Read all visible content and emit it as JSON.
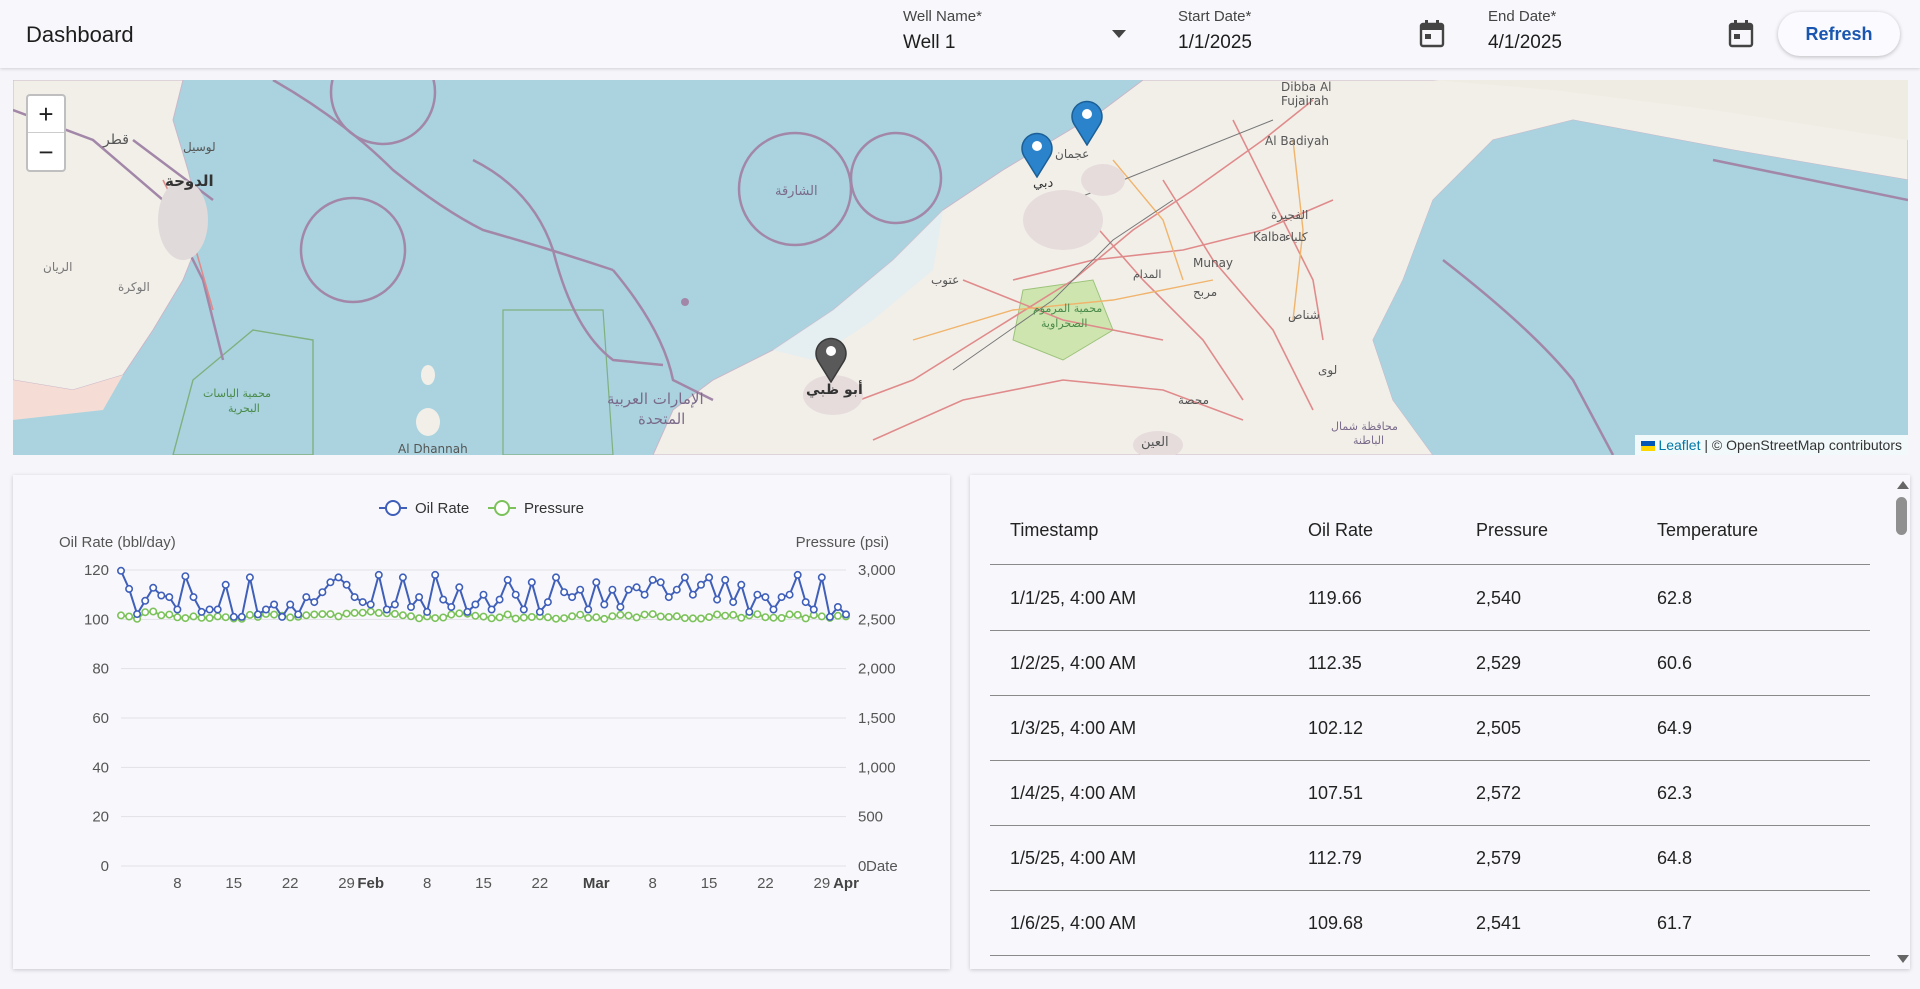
{
  "header": {
    "title": "Dashboard",
    "well_label": "Well Name*",
    "well_value": "Well 1",
    "start_label": "Start Date*",
    "start_value": "1/1/2025",
    "end_label": "End Date*",
    "end_value": "4/1/2025",
    "refresh_label": "Refresh"
  },
  "map": {
    "zoom_in": "+",
    "zoom_out": "−",
    "attribution_link": "Leaflet",
    "attribution_rest": "| © OpenStreetMap contributors",
    "markers": [
      {
        "color": "blue",
        "icon": "map-pin-icon"
      },
      {
        "color": "blue",
        "icon": "map-pin-icon"
      },
      {
        "color": "gray",
        "icon": "map-pin-icon"
      }
    ],
    "labels": [
      "قطر",
      "الدوحة",
      "لوسيل",
      "الريان",
      "الوكرة",
      "الشارقة",
      "عجمان",
      "دبي",
      "أبو ظبي",
      "الإمارات العربية",
      "المتحدة",
      "محمية الياسات",
      "البحرية",
      "Al Dhannah",
      "عتوب",
      "محمية المرموم",
      "الصحراوية",
      "Dibba Al",
      "Fujairah",
      "Al Badiyah",
      "الفجيرة",
      "Kalba",
      "كلباء",
      "Munay",
      "مربح",
      "شناص",
      "لوى",
      "محصة",
      "العين",
      "محافظة شمال",
      "الباطنة",
      "المدام"
    ]
  },
  "colors": {
    "oil": "#3f5fb9",
    "pressure": "#7cc25a",
    "accent": "#1a56b0"
  },
  "chart_data": {
    "type": "line",
    "legend": [
      "Oil Rate",
      "Pressure"
    ],
    "ylabel_left": "Oil Rate (bbl/day)",
    "ylabel_right": "Pressure (psi)",
    "xlabel": "Date",
    "ylim_left": [
      0,
      120
    ],
    "ylim_right": [
      0,
      3000
    ],
    "yticks_left": [
      "120",
      "100",
      "80",
      "60",
      "40",
      "20",
      "0"
    ],
    "yticks_right": [
      "3,000",
      "2,500",
      "2,000",
      "1,500",
      "1,000",
      "500",
      "0"
    ],
    "xticks": [
      {
        "label": "8",
        "day": 7,
        "bold": false
      },
      {
        "label": "15",
        "day": 14,
        "bold": false
      },
      {
        "label": "22",
        "day": 21,
        "bold": false
      },
      {
        "label": "29",
        "day": 28,
        "bold": false
      },
      {
        "label": "Feb",
        "day": 31,
        "bold": true
      },
      {
        "label": "8",
        "day": 38,
        "bold": false
      },
      {
        "label": "15",
        "day": 45,
        "bold": false
      },
      {
        "label": "22",
        "day": 52,
        "bold": false
      },
      {
        "label": "Mar",
        "day": 59,
        "bold": true
      },
      {
        "label": "8",
        "day": 66,
        "bold": false
      },
      {
        "label": "15",
        "day": 73,
        "bold": false
      },
      {
        "label": "22",
        "day": 80,
        "bold": false
      },
      {
        "label": "29",
        "day": 87,
        "bold": false
      },
      {
        "label": "Apr",
        "day": 90,
        "bold": true
      }
    ],
    "x": [
      "2025-01-01",
      "2025-01-02",
      "2025-01-03",
      "2025-01-04",
      "2025-01-05",
      "2025-01-06",
      "2025-01-07",
      "2025-01-08",
      "2025-01-09",
      "2025-01-10",
      "2025-01-11",
      "2025-01-12",
      "2025-01-13",
      "2025-01-14",
      "2025-01-15",
      "2025-01-16",
      "2025-01-17",
      "2025-01-18",
      "2025-01-19",
      "2025-01-20",
      "2025-01-21",
      "2025-01-22",
      "2025-01-23",
      "2025-01-24",
      "2025-01-25",
      "2025-01-26",
      "2025-01-27",
      "2025-01-28",
      "2025-01-29",
      "2025-01-30",
      "2025-01-31",
      "2025-02-01",
      "2025-02-02",
      "2025-02-03",
      "2025-02-04",
      "2025-02-05",
      "2025-02-06",
      "2025-02-07",
      "2025-02-08",
      "2025-02-09",
      "2025-02-10",
      "2025-02-11",
      "2025-02-12",
      "2025-02-13",
      "2025-02-14",
      "2025-02-15",
      "2025-02-16",
      "2025-02-17",
      "2025-02-18",
      "2025-02-19",
      "2025-02-20",
      "2025-02-21",
      "2025-02-22",
      "2025-02-23",
      "2025-02-24",
      "2025-02-25",
      "2025-02-26",
      "2025-02-27",
      "2025-02-28",
      "2025-03-01",
      "2025-03-02",
      "2025-03-03",
      "2025-03-04",
      "2025-03-05",
      "2025-03-06",
      "2025-03-07",
      "2025-03-08",
      "2025-03-09",
      "2025-03-10",
      "2025-03-11",
      "2025-03-12",
      "2025-03-13",
      "2025-03-14",
      "2025-03-15",
      "2025-03-16",
      "2025-03-17",
      "2025-03-18",
      "2025-03-19",
      "2025-03-20",
      "2025-03-21",
      "2025-03-22",
      "2025-03-23",
      "2025-03-24",
      "2025-03-25",
      "2025-03-26",
      "2025-03-27",
      "2025-03-28",
      "2025-03-29",
      "2025-03-30",
      "2025-03-31",
      "2025-04-01"
    ],
    "series": [
      {
        "name": "Oil Rate",
        "axis": "left",
        "values": [
          119.66,
          112.35,
          102.12,
          107.51,
          112.79,
          109.68,
          109,
          104,
          117.5,
          109,
          103,
          104,
          104,
          114,
          101,
          101,
          117,
          102,
          104,
          106,
          101,
          106,
          102,
          109,
          107,
          111,
          115,
          117,
          114,
          109,
          107,
          106,
          118,
          104,
          106,
          117,
          105,
          109,
          103,
          118,
          108,
          105,
          113,
          103,
          106,
          110,
          104,
          108,
          116,
          110,
          104,
          115,
          103,
          107,
          117,
          111,
          109,
          112,
          104,
          115,
          106,
          112,
          105,
          112,
          113,
          110,
          116,
          115,
          109,
          112,
          117,
          110,
          114,
          117,
          108,
          116,
          107,
          114,
          103,
          110,
          109,
          104,
          109,
          110,
          118,
          107,
          104,
          117,
          101,
          105,
          102
        ]
      },
      {
        "name": "Pressure",
        "axis": "right",
        "values": [
          2540,
          2529,
          2505,
          2572,
          2579,
          2541,
          2548,
          2521,
          2512,
          2530,
          2516,
          2514,
          2530,
          2522,
          2508,
          2505,
          2545,
          2525,
          2555,
          2548,
          2537,
          2520,
          2526,
          2541,
          2549,
          2553,
          2553,
          2530,
          2558,
          2565,
          2567,
          2578,
          2565,
          2561,
          2555,
          2541,
          2531,
          2510,
          2530,
          2513,
          2519,
          2548,
          2560,
          2557,
          2536,
          2528,
          2510,
          2520,
          2549,
          2507,
          2518,
          2524,
          2530,
          2521,
          2506,
          2511,
          2531,
          2547,
          2515,
          2521,
          2504,
          2532,
          2545,
          2538,
          2520,
          2548,
          2553,
          2529,
          2524,
          2531,
          2512,
          2509,
          2508,
          2523,
          2549,
          2537,
          2545,
          2516,
          2540,
          2552,
          2522,
          2517,
          2514,
          2550,
          2545,
          2509,
          2544,
          2530,
          2515,
          2536,
          2530
        ]
      }
    ]
  },
  "table": {
    "columns": [
      "Timestamp",
      "Oil Rate",
      "Pressure",
      "Temperature"
    ],
    "rows": [
      [
        "1/1/25, 4:00 AM",
        "119.66",
        "2,540",
        "62.8"
      ],
      [
        "1/2/25, 4:00 AM",
        "112.35",
        "2,529",
        "60.6"
      ],
      [
        "1/3/25, 4:00 AM",
        "102.12",
        "2,505",
        "64.9"
      ],
      [
        "1/4/25, 4:00 AM",
        "107.51",
        "2,572",
        "62.3"
      ],
      [
        "1/5/25, 4:00 AM",
        "112.79",
        "2,579",
        "64.8"
      ],
      [
        "1/6/25, 4:00 AM",
        "109.68",
        "2,541",
        "61.7"
      ]
    ]
  }
}
